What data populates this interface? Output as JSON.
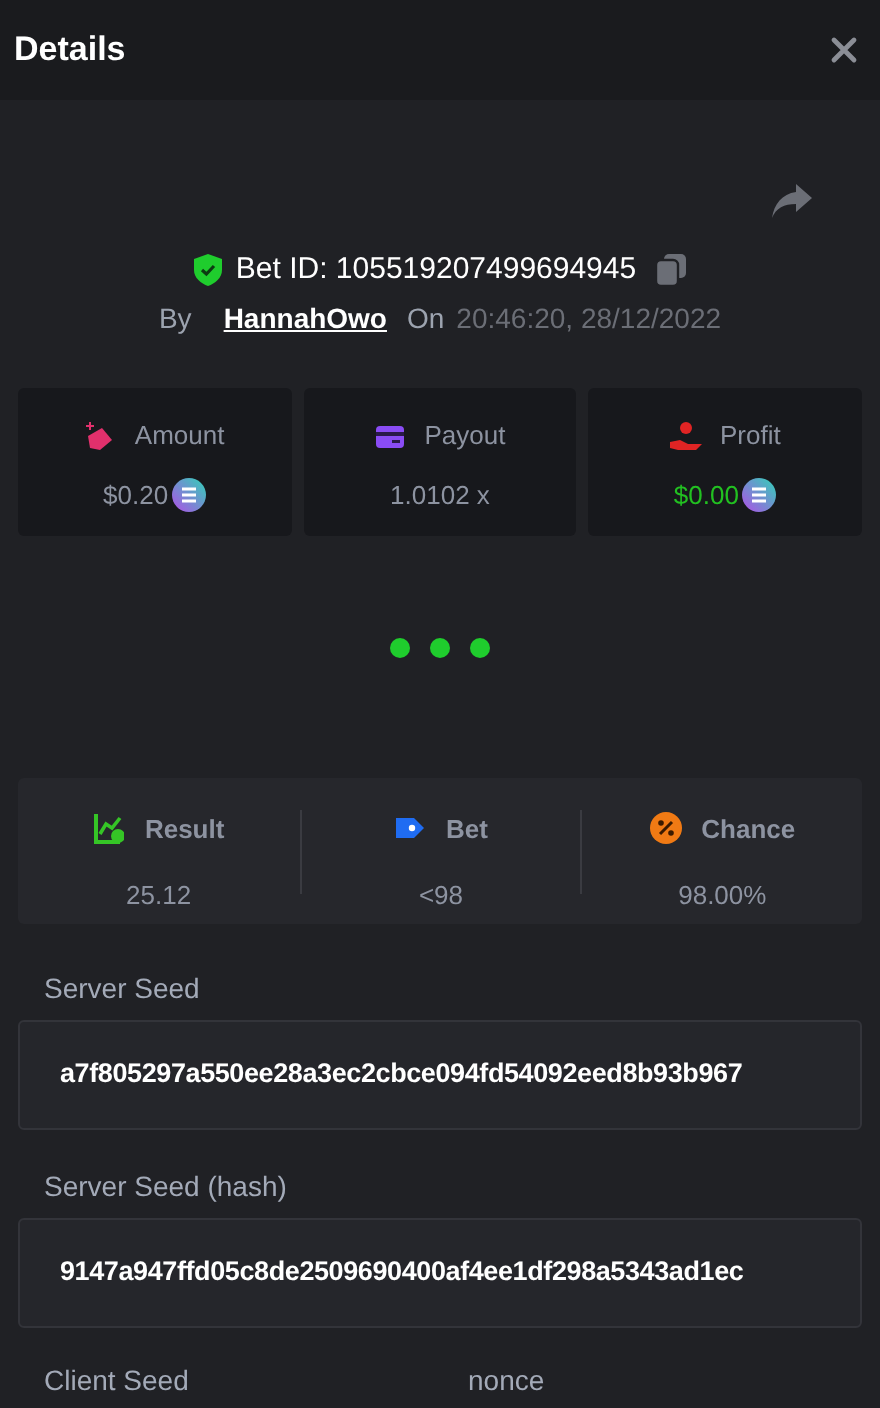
{
  "header": {
    "title": "Details"
  },
  "bet": {
    "id_label": "Bet ID: 105519207499694945",
    "by_label": "By",
    "user": "HannahOwo",
    "on_label": "On",
    "timestamp": "20:46:20, 28/12/2022"
  },
  "stats": [
    {
      "kind": "amount",
      "label": "Amount",
      "value": "$0.20",
      "coin": true,
      "highlight": false
    },
    {
      "kind": "payout",
      "label": "Payout",
      "value": "1.0102 x",
      "coin": false,
      "highlight": false
    },
    {
      "kind": "profit",
      "label": "Profit",
      "value": "$0.00",
      "coin": true,
      "highlight": true
    }
  ],
  "outcome": [
    {
      "kind": "result",
      "label": "Result",
      "value": "25.12"
    },
    {
      "kind": "bet",
      "label": "Bet",
      "value": "<98"
    },
    {
      "kind": "chance",
      "label": "Chance",
      "value": "98.00%"
    }
  ],
  "seeds": [
    {
      "label": "Server Seed",
      "value": "a7f805297a550ee28a3ec2cbce094fd54092eed8b93b967"
    },
    {
      "label": "Server Seed (hash)",
      "value": "9147a947ffd05c8de2509690400af4ee1df298a5343ad1ec"
    }
  ],
  "next_row": [
    {
      "label": "Client Seed"
    },
    {
      "label": "nonce"
    }
  ]
}
